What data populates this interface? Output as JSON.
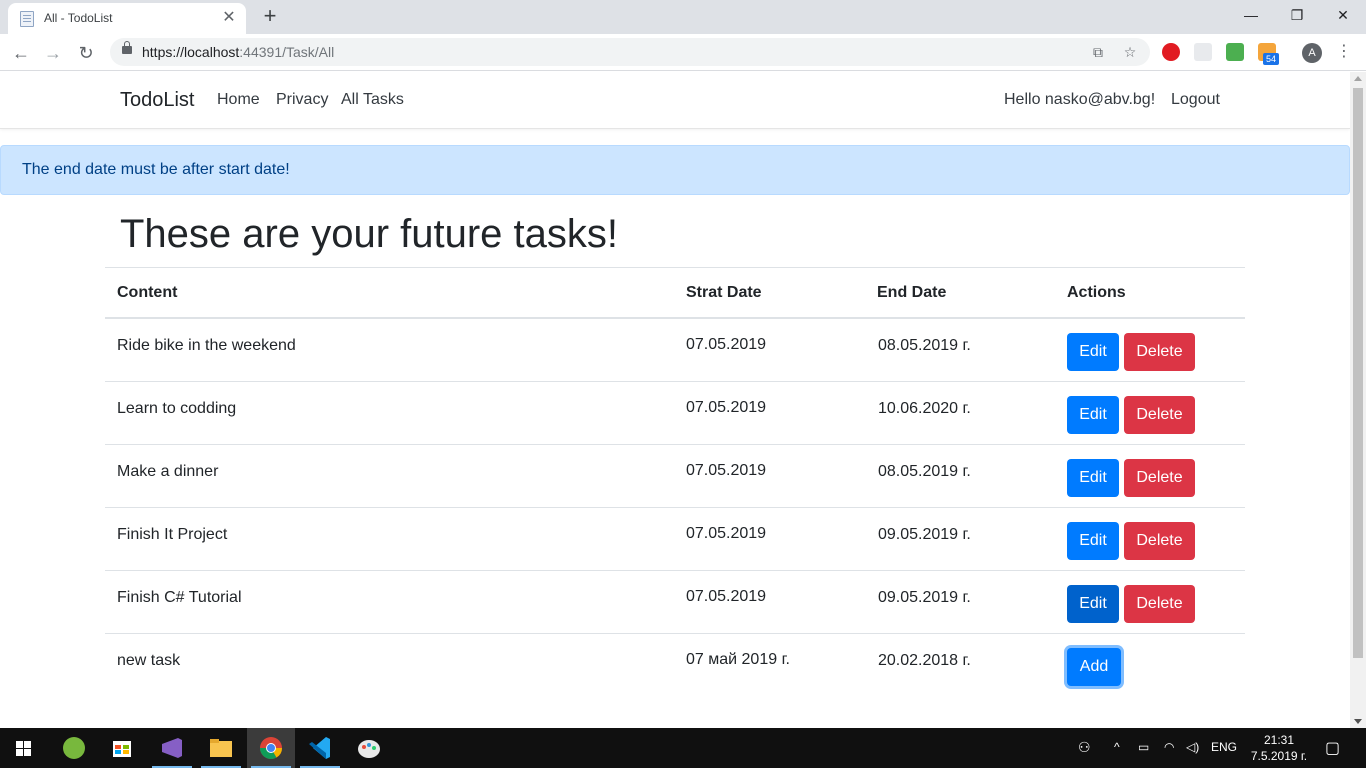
{
  "browser": {
    "tab_title": "All - TodoList",
    "url_host": "https://localhost",
    "url_rest": ":44391/Task/All",
    "extension_badge": "54",
    "profile_initial": "A"
  },
  "navbar": {
    "brand": "TodoList",
    "links": [
      "Home",
      "Privacy",
      "All Tasks"
    ],
    "greeting": "Hello nasko@abv.bg!",
    "logout": "Logout"
  },
  "alert": {
    "message": "The end date must be after start date!"
  },
  "page": {
    "heading": "These are your future tasks!"
  },
  "table": {
    "headers": [
      "Content",
      "Strat Date",
      "End Date",
      "Actions"
    ],
    "rows": [
      {
        "content": "Ride bike in the weekend",
        "start": "07.05.2019",
        "end": "08.05.2019 г."
      },
      {
        "content": "Learn to codding",
        "start": "07.05.2019",
        "end": "10.06.2020 г."
      },
      {
        "content": "Make a dinner",
        "start": "07.05.2019",
        "end": "08.05.2019 г."
      },
      {
        "content": "Finish It Project",
        "start": "07.05.2019",
        "end": "09.05.2019 г."
      },
      {
        "content": "Finish C# Tutorial",
        "start": "07.05.2019",
        "end": "09.05.2019 г."
      }
    ],
    "edit_label": "Edit",
    "delete_label": "Delete",
    "new_row": {
      "content": "new task",
      "start": "07 май 2019 г.",
      "end": "20.02.2018 г.",
      "add_label": "Add"
    }
  },
  "taskbar": {
    "language": "ENG",
    "time": "21:31",
    "date": "7.5.2019 г."
  },
  "colors": {
    "primary": "#007bff",
    "danger": "#dc3545",
    "alert_bg": "#cce5ff",
    "alert_text": "#004085"
  }
}
